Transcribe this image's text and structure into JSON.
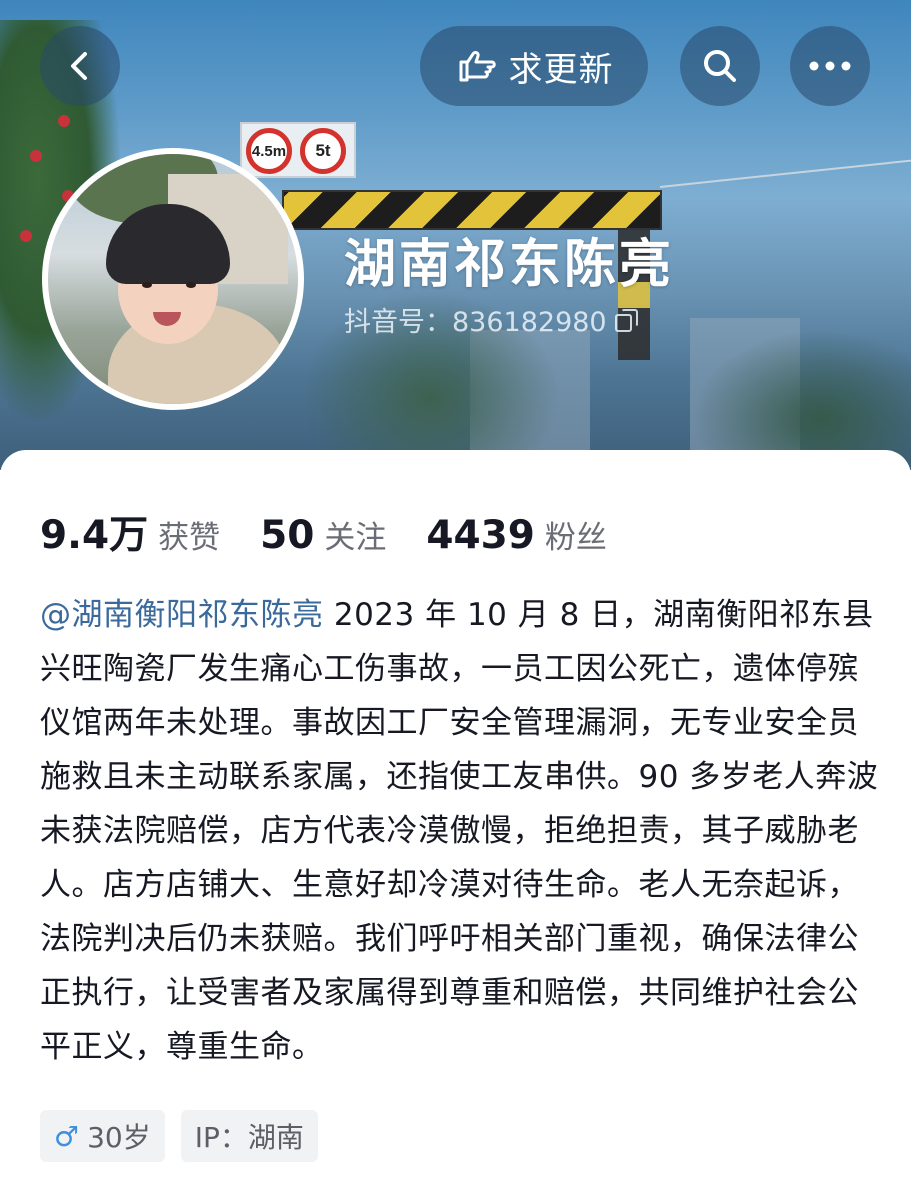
{
  "header": {
    "back_icon": "chevron-left-icon",
    "update_button": {
      "icon": "hand-pointing-icon",
      "label": "求更新"
    },
    "search_icon": "search-icon",
    "more_icon": "more-dots-icon",
    "banner_signs": [
      "4.5m",
      "5t"
    ]
  },
  "profile": {
    "name": "湖南祁东陈亮",
    "douyin_id": "抖音号：836182980",
    "copy_icon": "copy-icon"
  },
  "stats": [
    {
      "value": "9.4万",
      "label": "获赞"
    },
    {
      "value": "50",
      "label": "关注"
    },
    {
      "value": "4439",
      "label": "粉丝"
    }
  ],
  "bio": {
    "mention": "@湖南衡阳祁东陈亮",
    "text": " 2023 年 10 月 8 日，湖南衡阳祁东县兴旺陶瓷厂发生痛心工伤事故，一员工因公死亡，遗体停殡仪馆两年未处理。事故因工厂安全管理漏洞，无专业安全员施救且未主动联系家属，还指使工友串供。90 多岁老人奔波未获法院赔偿，店方代表冷漠傲慢，拒绝担责，其子威胁老人。店方店铺大、生意好却冷漠对待生命。老人无奈起诉，法院判决后仍未获赔。我们呼吁相关部门重视，确保法律公正执行，让受害者及家属得到尊重和赔偿，共同维护社会公平正义，尊重生命。"
  },
  "tags": {
    "gender_icon": "male-icon",
    "age": "30岁",
    "ip": "IP：湖南"
  },
  "colors": {
    "mention": "#3a6a9c",
    "text": "#161823",
    "secondary": "#6b6d76",
    "male": "#3d8fe0"
  }
}
